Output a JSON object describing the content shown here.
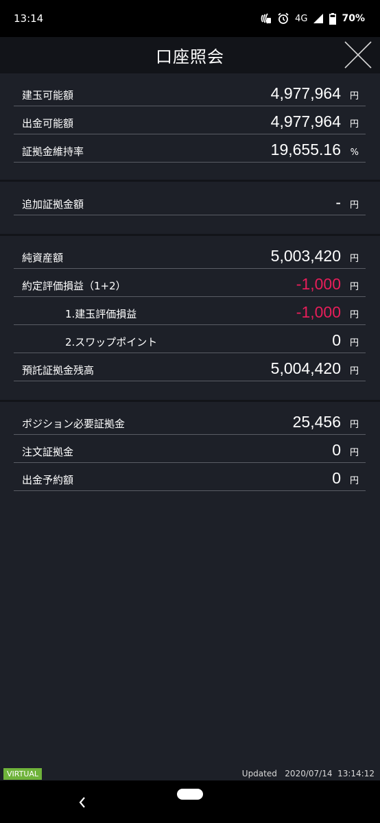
{
  "status_bar": {
    "time": "13:14",
    "network": "4G",
    "battery": "70%"
  },
  "header": {
    "title": "口座照会"
  },
  "section1": [
    {
      "label": "建玉可能額",
      "value": "4,977,964",
      "unit": "円"
    },
    {
      "label": "出金可能額",
      "value": "4,977,964",
      "unit": "円"
    },
    {
      "label": "証拠金維持率",
      "value": "19,655.16",
      "unit": "%"
    }
  ],
  "section2": [
    {
      "label": "追加証拠金額",
      "value": "-",
      "unit": "円"
    }
  ],
  "section3": [
    {
      "label": "純資産額",
      "value": "5,003,420",
      "unit": "円"
    },
    {
      "label": "約定評価損益（1+2）",
      "value": "-1,000",
      "unit": "円"
    },
    {
      "label": "1.建玉評価損益",
      "value": "-1,000",
      "unit": "円"
    },
    {
      "label": "2.スワップポイント",
      "value": "0",
      "unit": "円"
    },
    {
      "label": "預託証拠金残高",
      "value": "5,004,420",
      "unit": "円"
    }
  ],
  "section4": [
    {
      "label": "ポジション必要証拠金",
      "value": "25,456",
      "unit": "円"
    },
    {
      "label": "注文証拠金",
      "value": "0",
      "unit": "円"
    },
    {
      "label": "出金予約額",
      "value": "0",
      "unit": "円"
    }
  ],
  "footer": {
    "badge": "VIRTUAL",
    "updated": "Updated   2020/07/14  13:14:12"
  },
  "colors": {
    "background": "#1d2028",
    "header_background": "#121419",
    "negative": "#e81e5a",
    "badge": "#6fb33b"
  },
  "icons": {
    "close": "close-icon",
    "back": "back-icon",
    "alarm": "alarm-icon",
    "signal": "signal-icon",
    "battery": "battery-icon",
    "nfc": "nfc-icon"
  }
}
